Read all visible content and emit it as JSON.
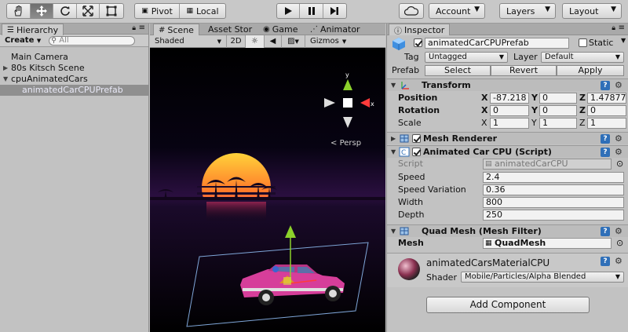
{
  "toolbar": {
    "pivot_label": "Pivot",
    "local_label": "Local",
    "account_label": "Account",
    "layers_label": "Layers",
    "layout_label": "Layout"
  },
  "hierarchy": {
    "tab_label": "Hierarchy",
    "create_label": "Create",
    "search_placeholder": "All",
    "items": [
      {
        "label": "Main Camera"
      },
      {
        "label": "80s Kitsch Scene"
      },
      {
        "label": "cpuAnimatedCars"
      },
      {
        "label": "animatedCarCPUPrefab"
      }
    ]
  },
  "scene": {
    "tabs": [
      {
        "label": "Scene"
      },
      {
        "label": "Asset Stor"
      },
      {
        "label": "Game"
      },
      {
        "label": "Animator"
      }
    ],
    "shading_label": "Shaded",
    "mode_2d_label": "2D",
    "gizmos_label": "Gizmos",
    "gizmo_axis_y": "y",
    "gizmo_axis_x": "x",
    "persp_label": "Persp"
  },
  "inspector": {
    "tab_label": "Inspector",
    "object_name": "animatedCarCPUPrefab",
    "static_label": "Static",
    "tag_label": "Tag",
    "tag_value": "Untagged",
    "layer_label": "Layer",
    "layer_value": "Default",
    "prefab_label": "Prefab",
    "select_label": "Select",
    "revert_label": "Revert",
    "apply_label": "Apply",
    "transform": {
      "title": "Transform",
      "position_label": "Position",
      "rotation_label": "Rotation",
      "scale_label": "Scale",
      "x": "X",
      "y": "Y",
      "z": "Z",
      "pos_x": "-87.218",
      "pos_y": "0",
      "pos_z": "1.47877",
      "rot_x": "0",
      "rot_y": "0",
      "rot_z": "0",
      "scale_x": "1",
      "scale_y": "1",
      "scale_z": "1"
    },
    "mesh_renderer_title": "Mesh Renderer",
    "script_component": {
      "title": "Animated Car CPU (Script)",
      "script_label": "Script",
      "script_value": "animatedCarCPU",
      "speed_label": "Speed",
      "speed_value": "2.4",
      "speed_variation_label": "Speed Variation",
      "speed_variation_value": "0.36",
      "width_label": "Width",
      "width_value": "800",
      "depth_label": "Depth",
      "depth_value": "250"
    },
    "mesh_filter": {
      "title": "Quad Mesh (Mesh Filter)",
      "mesh_label": "Mesh",
      "mesh_value": "QuadMesh"
    },
    "material": {
      "name": "animatedCarsMaterialCPU",
      "shader_label": "Shader",
      "shader_value": "Mobile/Particles/Alpha Blended"
    },
    "add_component_label": "Add Component"
  },
  "colors": {
    "selection": "#8f8f8f",
    "script_blue": "#2f6fb8",
    "sun_top": "#ffd23a",
    "sun_bottom": "#ff3b6b",
    "horizon": "#2a0f3f"
  }
}
